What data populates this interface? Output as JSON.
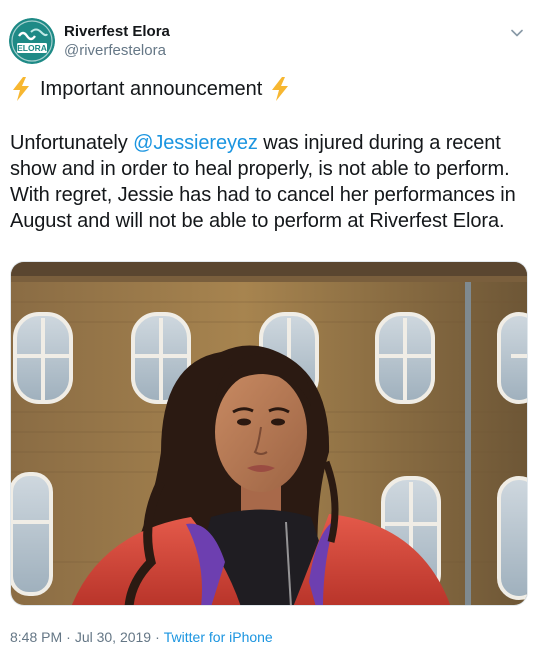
{
  "account": {
    "display_name": "Riverfest Elora",
    "handle": "@riverfestelora",
    "avatar_text": "ELORA"
  },
  "tweet": {
    "headline_text": "Important announcement",
    "headline_icon": "lightning-bolt-icon",
    "body_before_mention": "Unfortunately ",
    "mention": "@Jessiereyez",
    "body_after_mention": " was injured during a recent show and in order to heal properly, is not able to perform. With regret, Jessie has had to cancel her performances in August and will not be able to perform at Riverfest Elora."
  },
  "footer": {
    "time": "8:48 PM",
    "date": "Jul 30, 2019",
    "separator": "·",
    "source": "Twitter for iPhone"
  },
  "colors": {
    "link": "#1b95e0",
    "secondary_text": "#657786",
    "avatar_teal": "#1e8a86",
    "bolt": "#f7b731"
  }
}
